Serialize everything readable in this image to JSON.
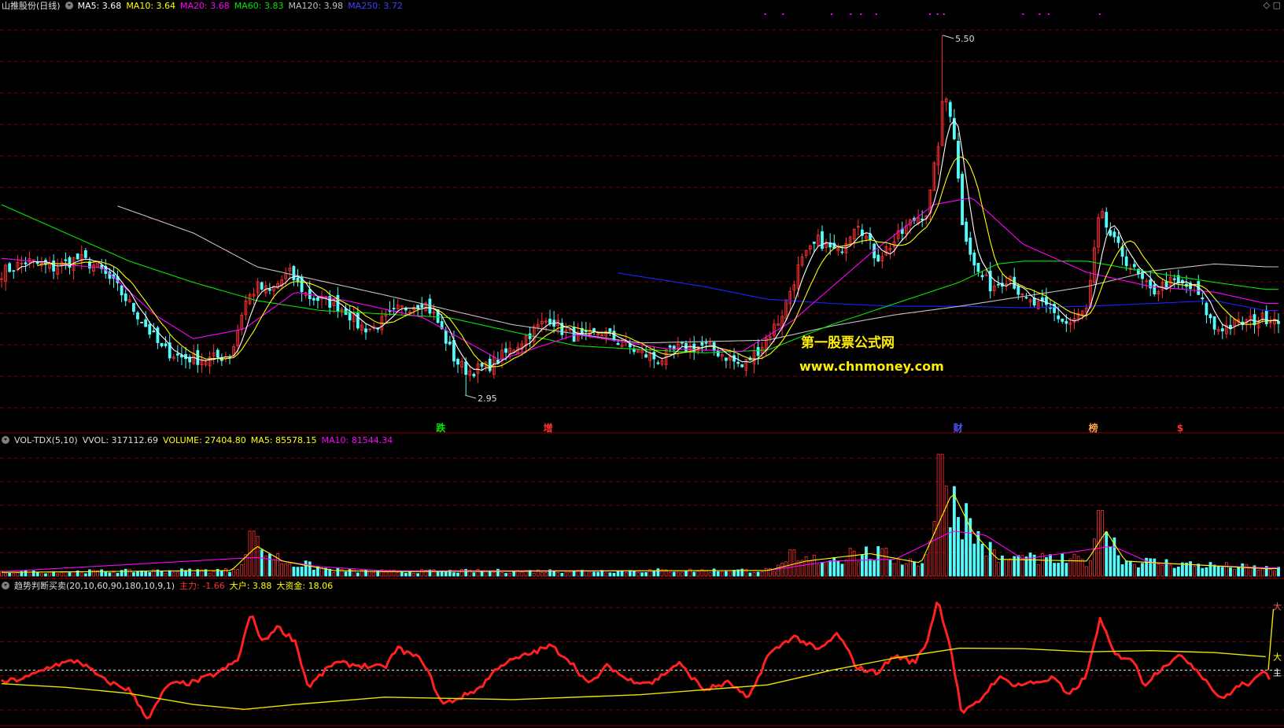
{
  "colors": {
    "bg": "#000000",
    "up": "#ff3232",
    "down": "#54fcfc",
    "ma5": "#ffffff",
    "ma10": "#ffff00",
    "ma20": "#ff00ff",
    "ma60": "#00e600",
    "ma120": "#c0c0c0",
    "ma250": "#2020ff",
    "grid": "#7a0000"
  },
  "main_header": {
    "title": "山推股份(日线)",
    "indicators": [
      {
        "label": "MA5: 3.68",
        "color": "#ffffff"
      },
      {
        "label": "MA10: 3.64",
        "color": "#ffff00"
      },
      {
        "label": "MA20: 3.68",
        "color": "#ff00ff"
      },
      {
        "label": "MA60: 3.83",
        "color": "#00e600"
      },
      {
        "label": "MA120: 3.98",
        "color": "#c0c0c0"
      },
      {
        "label": "MA250: 3.72",
        "color": "#4040ff"
      }
    ]
  },
  "vol_header": {
    "title": "VOL-TDX(5,10)",
    "indicators": [
      {
        "label": "VVOL: 317112.69",
        "color": "#dddddd"
      },
      {
        "label": "VOLUME: 27404.80",
        "color": "#ffff00"
      },
      {
        "label": "MA5: 85578.15",
        "color": "#ffff00"
      },
      {
        "label": "MA10: 81544.34",
        "color": "#ff00ff"
      }
    ]
  },
  "ind_header": {
    "title": "趋势判断买卖(20,10,60,90,180,10,9,1)",
    "indicators": [
      {
        "label": "主力: -1.66",
        "color": "#ff3232"
      },
      {
        "label": "大户: 3.88",
        "color": "#ffff00"
      },
      {
        "label": "大资金: 18.06",
        "color": "#ffff00"
      }
    ]
  },
  "watermark": {
    "line1": "第一股票公式网",
    "line2": "www.chnmoney.com",
    "color": "#ffee00"
  },
  "chart_data": [
    {
      "type": "candlestick",
      "ylim": [
        2.75,
        5.65
      ],
      "annotations": [
        {
          "label": "5.50",
          "x": 0.737,
          "y": 5.5
        },
        {
          "label": "2.95",
          "x": 0.363,
          "y": 2.95
        }
      ],
      "event_markers": [
        {
          "label": "跌",
          "x": 0.344,
          "color": "#00e600"
        },
        {
          "label": "增",
          "x": 0.428,
          "color": "#ff3232"
        },
        {
          "label": "财",
          "x": 0.749,
          "color": "#5050ff"
        },
        {
          "label": "榜",
          "x": 0.855,
          "color": "#ffa040"
        },
        {
          "label": "$",
          "x": 0.923,
          "color": "#ff3232"
        }
      ],
      "price_anchors": [
        [
          0,
          3.82
        ],
        [
          0.02,
          3.9
        ],
        [
          0.04,
          3.85
        ],
        [
          0.06,
          3.92
        ],
        [
          0.075,
          3.86
        ],
        [
          0.09,
          3.72
        ],
        [
          0.11,
          3.48
        ],
        [
          0.125,
          3.28
        ],
        [
          0.14,
          3.22
        ],
        [
          0.16,
          3.2
        ],
        [
          0.18,
          3.24
        ],
        [
          0.19,
          3.6
        ],
        [
          0.2,
          3.72
        ],
        [
          0.21,
          3.68
        ],
        [
          0.225,
          3.82
        ],
        [
          0.24,
          3.65
        ],
        [
          0.26,
          3.6
        ],
        [
          0.27,
          3.55
        ],
        [
          0.28,
          3.44
        ],
        [
          0.29,
          3.42
        ],
        [
          0.31,
          3.55
        ],
        [
          0.33,
          3.62
        ],
        [
          0.34,
          3.5
        ],
        [
          0.355,
          3.2
        ],
        [
          0.365,
          3.12
        ],
        [
          0.38,
          3.15
        ],
        [
          0.4,
          3.28
        ],
        [
          0.415,
          3.4
        ],
        [
          0.43,
          3.5
        ],
        [
          0.44,
          3.4
        ],
        [
          0.455,
          3.35
        ],
        [
          0.47,
          3.4
        ],
        [
          0.485,
          3.32
        ],
        [
          0.5,
          3.25
        ],
        [
          0.515,
          3.2
        ],
        [
          0.53,
          3.28
        ],
        [
          0.55,
          3.3
        ],
        [
          0.565,
          3.24
        ],
        [
          0.58,
          3.15
        ],
        [
          0.595,
          3.3
        ],
        [
          0.61,
          3.5
        ],
        [
          0.625,
          3.88
        ],
        [
          0.64,
          4.05
        ],
        [
          0.655,
          3.95
        ],
        [
          0.67,
          4.2
        ],
        [
          0.685,
          3.92
        ],
        [
          0.7,
          4.05
        ],
        [
          0.715,
          4.2
        ],
        [
          0.725,
          4.25
        ],
        [
          0.733,
          4.7
        ],
        [
          0.738,
          5.1
        ],
        [
          0.745,
          4.9
        ],
        [
          0.752,
          4.2
        ],
        [
          0.762,
          3.85
        ],
        [
          0.775,
          3.72
        ],
        [
          0.79,
          3.8
        ],
        [
          0.8,
          3.62
        ],
        [
          0.82,
          3.56
        ],
        [
          0.835,
          3.45
        ],
        [
          0.85,
          3.56
        ],
        [
          0.86,
          4.25
        ],
        [
          0.87,
          4.05
        ],
        [
          0.885,
          3.85
        ],
        [
          0.9,
          3.68
        ],
        [
          0.915,
          3.75
        ],
        [
          0.935,
          3.7
        ],
        [
          0.95,
          3.42
        ],
        [
          0.965,
          3.45
        ],
        [
          0.98,
          3.48
        ],
        [
          0.99,
          3.5
        ]
      ],
      "ma_anchors": {
        "ma20": [
          [
            0,
            3.92
          ],
          [
            0.08,
            3.85
          ],
          [
            0.12,
            3.52
          ],
          [
            0.15,
            3.35
          ],
          [
            0.19,
            3.42
          ],
          [
            0.23,
            3.68
          ],
          [
            0.27,
            3.62
          ],
          [
            0.33,
            3.5
          ],
          [
            0.39,
            3.2
          ],
          [
            0.45,
            3.38
          ],
          [
            0.52,
            3.28
          ],
          [
            0.58,
            3.26
          ],
          [
            0.62,
            3.48
          ],
          [
            0.68,
            3.95
          ],
          [
            0.73,
            4.3
          ],
          [
            0.76,
            4.35
          ],
          [
            0.8,
            4.02
          ],
          [
            0.85,
            3.82
          ],
          [
            0.9,
            3.72
          ],
          [
            0.95,
            3.68
          ],
          [
            0.99,
            3.6
          ]
        ],
        "ma60": [
          [
            0,
            4.3
          ],
          [
            0.05,
            4.1
          ],
          [
            0.1,
            3.9
          ],
          [
            0.15,
            3.75
          ],
          [
            0.2,
            3.62
          ],
          [
            0.25,
            3.55
          ],
          [
            0.35,
            3.5
          ],
          [
            0.45,
            3.3
          ],
          [
            0.55,
            3.25
          ],
          [
            0.6,
            3.27
          ],
          [
            0.65,
            3.45
          ],
          [
            0.7,
            3.6
          ],
          [
            0.75,
            3.75
          ],
          [
            0.78,
            3.88
          ],
          [
            0.8,
            3.9
          ],
          [
            0.85,
            3.9
          ],
          [
            0.9,
            3.82
          ],
          [
            0.95,
            3.75
          ],
          [
            0.99,
            3.7
          ]
        ],
        "ma120": [
          [
            0.088,
            4.3
          ],
          [
            0.15,
            4.1
          ],
          [
            0.2,
            3.86
          ],
          [
            0.3,
            3.66
          ],
          [
            0.4,
            3.45
          ],
          [
            0.5,
            3.32
          ],
          [
            0.6,
            3.34
          ],
          [
            0.65,
            3.44
          ],
          [
            0.7,
            3.52
          ],
          [
            0.75,
            3.58
          ],
          [
            0.8,
            3.65
          ],
          [
            0.85,
            3.72
          ],
          [
            0.9,
            3.83
          ],
          [
            0.95,
            3.88
          ],
          [
            0.99,
            3.86
          ]
        ],
        "ma250": [
          [
            0.48,
            3.82
          ],
          [
            0.55,
            3.72
          ],
          [
            0.6,
            3.63
          ],
          [
            0.65,
            3.6
          ],
          [
            0.7,
            3.58
          ],
          [
            0.75,
            3.58
          ],
          [
            0.8,
            3.57
          ],
          [
            0.85,
            3.58
          ],
          [
            0.9,
            3.6
          ],
          [
            0.95,
            3.62
          ],
          [
            0.99,
            3.55
          ]
        ]
      },
      "ma_series": [
        {
          "name": "MA5",
          "key": "ma5",
          "color": "#ffffff"
        },
        {
          "name": "MA10",
          "key": "ma10",
          "color": "#ffff00"
        },
        {
          "name": "MA20",
          "key": "ma20",
          "color": "#ff00ff"
        },
        {
          "name": "MA60",
          "key": "ma60",
          "color": "#00e600"
        },
        {
          "name": "MA120",
          "key": "ma120",
          "color": "#c0c0c0"
        },
        {
          "name": "MA250",
          "key": "ma250",
          "color": "#2020ff"
        }
      ]
    },
    {
      "type": "bar",
      "ylim": [
        0,
        340000
      ],
      "spikes": [
        [
          0.735,
          325000
        ],
        [
          0.74,
          240000
        ],
        [
          0.86,
          175000
        ],
        [
          0.195,
          120000
        ],
        [
          0.62,
          70000
        ],
        [
          0.665,
          75000
        ],
        [
          0.8,
          55000
        ]
      ],
      "ma5_anchors": [
        [
          0,
          10000
        ],
        [
          0.18,
          15000
        ],
        [
          0.2,
          80000
        ],
        [
          0.22,
          40000
        ],
        [
          0.26,
          15000
        ],
        [
          0.3,
          12000
        ],
        [
          0.6,
          15000
        ],
        [
          0.63,
          40000
        ],
        [
          0.68,
          60000
        ],
        [
          0.72,
          35000
        ],
        [
          0.745,
          225000
        ],
        [
          0.76,
          120000
        ],
        [
          0.78,
          45000
        ],
        [
          0.85,
          40000
        ],
        [
          0.865,
          120000
        ],
        [
          0.88,
          40000
        ],
        [
          0.99,
          20000
        ]
      ],
      "ma10_anchors": [
        [
          0,
          12000
        ],
        [
          0.2,
          50000
        ],
        [
          0.25,
          25000
        ],
        [
          0.3,
          14000
        ],
        [
          0.6,
          15000
        ],
        [
          0.65,
          40000
        ],
        [
          0.7,
          45000
        ],
        [
          0.745,
          120000
        ],
        [
          0.77,
          110000
        ],
        [
          0.8,
          45000
        ],
        [
          0.87,
          80000
        ],
        [
          0.9,
          35000
        ],
        [
          0.99,
          22000
        ]
      ]
    },
    {
      "type": "line",
      "ylim": [
        -2.2,
        3.2
      ],
      "zero_line": 0,
      "series": [
        {
          "name": "主力",
          "color": "#ff2020",
          "width": 3,
          "points": [
            [
              0,
              -0.5
            ],
            [
              0.02,
              -0.3
            ],
            [
              0.04,
              0.2
            ],
            [
              0.06,
              0.4
            ],
            [
              0.08,
              -0.4
            ],
            [
              0.1,
              -0.8
            ],
            [
              0.115,
              -2.0
            ],
            [
              0.13,
              -0.6
            ],
            [
              0.15,
              -0.5
            ],
            [
              0.17,
              -0.1
            ],
            [
              0.185,
              0.4
            ],
            [
              0.195,
              2.3
            ],
            [
              0.205,
              1.1
            ],
            [
              0.215,
              1.8
            ],
            [
              0.23,
              1.2
            ],
            [
              0.24,
              -0.7
            ],
            [
              0.26,
              0.3
            ],
            [
              0.28,
              0.2
            ],
            [
              0.3,
              0.1
            ],
            [
              0.31,
              0.9
            ],
            [
              0.33,
              0.4
            ],
            [
              0.345,
              -1.4
            ],
            [
              0.36,
              -1.1
            ],
            [
              0.375,
              -0.7
            ],
            [
              0.39,
              0.2
            ],
            [
              0.41,
              0.6
            ],
            [
              0.43,
              1.0
            ],
            [
              0.445,
              0.4
            ],
            [
              0.46,
              -0.6
            ],
            [
              0.475,
              0.2
            ],
            [
              0.49,
              -0.4
            ],
            [
              0.51,
              -0.5
            ],
            [
              0.53,
              0.3
            ],
            [
              0.55,
              -0.8
            ],
            [
              0.57,
              -0.5
            ],
            [
              0.585,
              -1.2
            ],
            [
              0.6,
              0.6
            ],
            [
              0.62,
              1.4
            ],
            [
              0.64,
              0.8
            ],
            [
              0.655,
              1.5
            ],
            [
              0.67,
              0.1
            ],
            [
              0.685,
              -0.1
            ],
            [
              0.7,
              0.6
            ],
            [
              0.715,
              0.3
            ],
            [
              0.725,
              1.2
            ],
            [
              0.733,
              2.9
            ],
            [
              0.743,
              1.0
            ],
            [
              0.752,
              -1.8
            ],
            [
              0.765,
              -1.3
            ],
            [
              0.78,
              -0.3
            ],
            [
              0.795,
              -0.6
            ],
            [
              0.81,
              -0.5
            ],
            [
              0.825,
              -0.3
            ],
            [
              0.835,
              -1.1
            ],
            [
              0.85,
              -0.2
            ],
            [
              0.86,
              2.1
            ],
            [
              0.872,
              0.6
            ],
            [
              0.885,
              0.5
            ],
            [
              0.895,
              -0.6
            ],
            [
              0.91,
              0.2
            ],
            [
              0.925,
              0.6
            ],
            [
              0.94,
              -0.2
            ],
            [
              0.955,
              -1.2
            ],
            [
              0.97,
              -0.6
            ],
            [
              0.98,
              -0.5
            ],
            [
              0.99,
              0.0
            ],
            [
              0.993,
              -0.3
            ]
          ]
        },
        {
          "name": "大户",
          "color": "#e6e600",
          "width": 1.4,
          "points": [
            [
              0,
              -0.55
            ],
            [
              0.05,
              -0.7
            ],
            [
              0.1,
              -0.95
            ],
            [
              0.15,
              -1.4
            ],
            [
              0.19,
              -1.6
            ],
            [
              0.23,
              -1.4
            ],
            [
              0.3,
              -1.1
            ],
            [
              0.4,
              -1.2
            ],
            [
              0.5,
              -1.0
            ],
            [
              0.6,
              -0.6
            ],
            [
              0.65,
              0.0
            ],
            [
              0.7,
              0.5
            ],
            [
              0.75,
              0.9
            ],
            [
              0.8,
              0.88
            ],
            [
              0.85,
              0.75
            ],
            [
              0.9,
              0.8
            ],
            [
              0.95,
              0.72
            ],
            [
              0.99,
              0.55
            ]
          ]
        },
        {
          "name": "大资金",
          "color": "#e6e600",
          "width": 1.4,
          "points": [
            [
              0.992,
              0.0
            ],
            [
              0.996,
              2.5
            ]
          ]
        }
      ],
      "end_labels": [
        {
          "label": "大",
          "y": 2.6,
          "color": "#ff6060"
        },
        {
          "label": "大",
          "y": 0.55,
          "color": "#ffff00"
        },
        {
          "label": "主",
          "y": -0.1,
          "color": "#ffffff"
        }
      ]
    }
  ]
}
